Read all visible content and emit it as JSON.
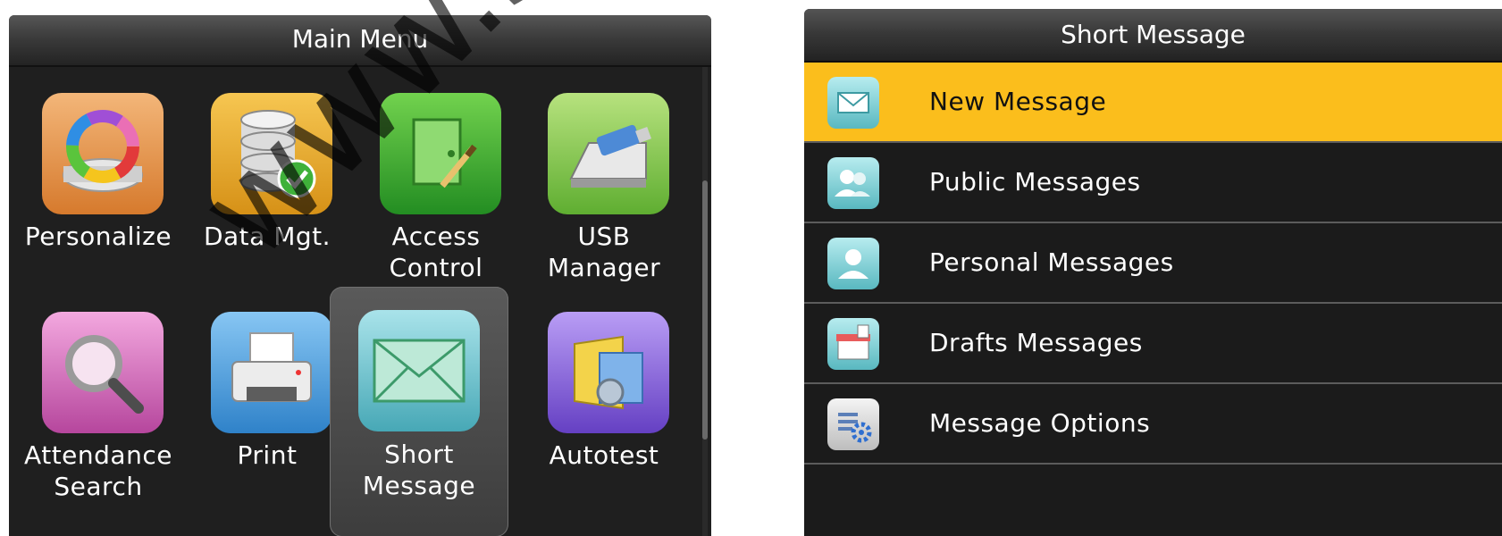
{
  "main_menu": {
    "title": "Main Menu",
    "items": [
      {
        "label": "Personalize",
        "icon": "personalize-icon"
      },
      {
        "label": "Data Mgt.",
        "icon": "database-icon"
      },
      {
        "label": "Access\nControl",
        "icon": "access-control-icon"
      },
      {
        "label": "USB\nManager",
        "icon": "usb-drive-icon"
      },
      {
        "label": "Attendance\nSearch",
        "icon": "magnifier-icon"
      },
      {
        "label": "Print",
        "icon": "printer-icon"
      },
      {
        "label": "Short\nMessage",
        "icon": "envelope-icon",
        "selected": true
      },
      {
        "label": "Autotest",
        "icon": "autotest-icon"
      }
    ]
  },
  "short_message": {
    "title": "Short Message",
    "items": [
      {
        "label": "New Message",
        "icon": "new-message-icon",
        "selected": true
      },
      {
        "label": "Public Messages",
        "icon": "public-messages-icon"
      },
      {
        "label": "Personal Messages",
        "icon": "personal-messages-icon"
      },
      {
        "label": "Drafts Messages",
        "icon": "drafts-icon"
      },
      {
        "label": "Message Options",
        "icon": "options-icon"
      }
    ]
  },
  "colors": {
    "selected_row": "#fbbe1c",
    "panel_background": "#1f1f1f",
    "text": "#ffffff"
  },
  "watermark": {
    "text": "www.sec.com"
  }
}
